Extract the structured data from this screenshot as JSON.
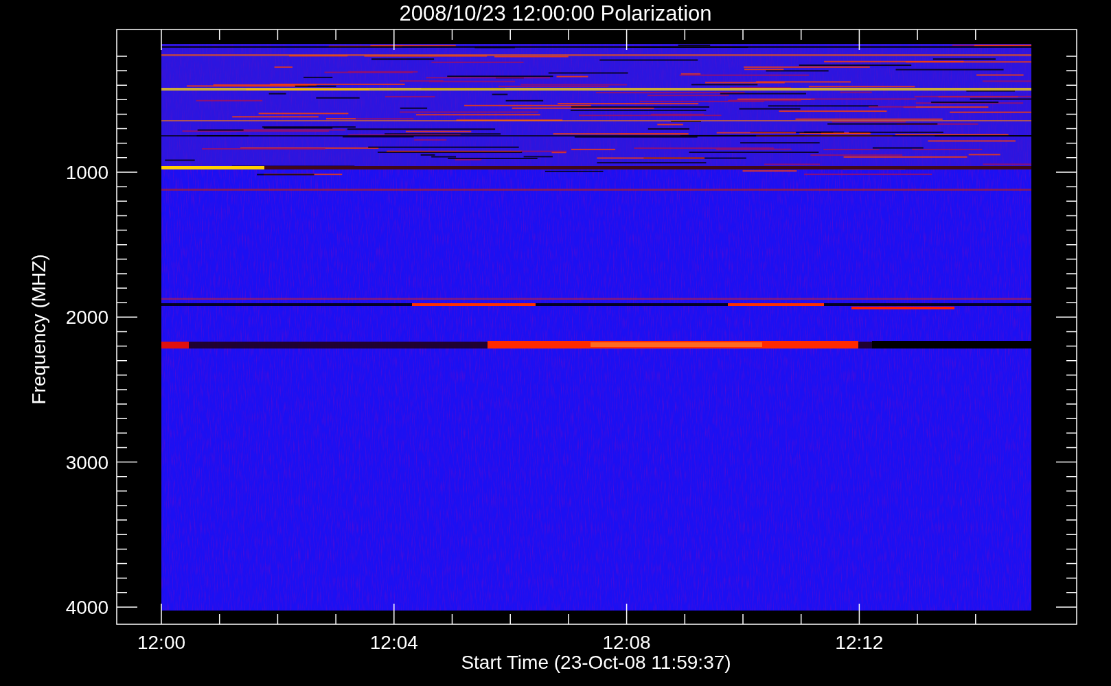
{
  "title": "2008/10/23 12:00:00 Polarization",
  "y_axis": {
    "label": "Frequency (MHZ)",
    "ticks": [
      "1000",
      "2000",
      "3000",
      "4000"
    ]
  },
  "x_axis": {
    "label": "Start Time (23-Oct-08 11:59:37)",
    "ticks": [
      "12:00",
      "12:04",
      "12:08",
      "12:12"
    ]
  }
}
